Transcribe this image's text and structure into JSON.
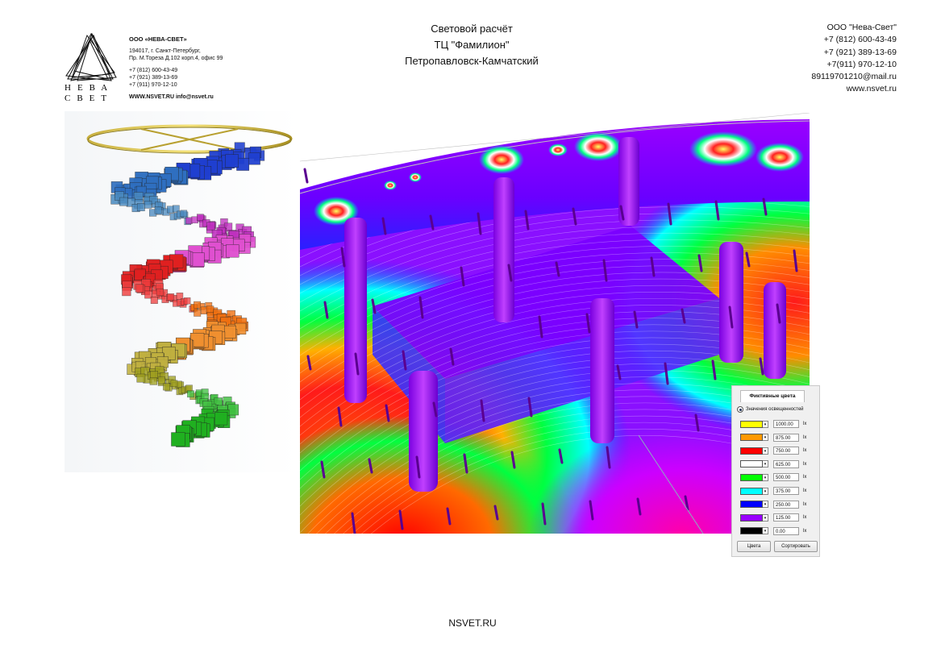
{
  "logo": {
    "top_word": "НЕВА",
    "bottom_word": "СВЕТ",
    "company_name": "ООО «НЕВА-СВЕТ»",
    "address_line1": "194017, г. Санкт-Петербург,",
    "address_line2": "Пр. М.Тореза Д.102 корп.4, офис 99",
    "phone1": "+7 (812) 600-43-49",
    "phone2": "+7 (921) 389-13-69",
    "phone3": "+7 (911) 970-12-10",
    "web": "WWW.NSVET.RU info@nsvet.ru"
  },
  "title": {
    "line1": "Световой расчёт",
    "line2": "ТЦ \"Фамилион\"",
    "line3": "Петропавловск-Камчатский"
  },
  "contacts": {
    "company": "ООО \"Нева-Свет\"",
    "phone1": "+7 (812) 600-43-49",
    "phone2": "+7 (921) 389-13-69",
    "phone3": "+7(911) 970-12-10",
    "email": "89119701210@mail.ru",
    "site": "www.nsvet.ru"
  },
  "legend": {
    "tab_label": "Фиктивные цвета",
    "radio_label": "Значения освещенностей",
    "unit": "lx",
    "rows": [
      {
        "color": "#ffff00",
        "value": "1000.00"
      },
      {
        "color": "#ff9900",
        "value": "875.00"
      },
      {
        "color": "#ff0000",
        "value": "750.00"
      },
      {
        "color": "#ffffff",
        "value": "625.00"
      },
      {
        "color": "#00ff00",
        "value": "500.00"
      },
      {
        "color": "#00ffff",
        "value": "375.00"
      },
      {
        "color": "#0000ff",
        "value": "250.00"
      },
      {
        "color": "#9900ff",
        "value": "125.00"
      },
      {
        "color": "#000000",
        "value": "0.00"
      }
    ],
    "btn_colors": "Цвета",
    "btn_sort": "Сортировать"
  },
  "footer": {
    "text": "NSVET.RU"
  }
}
